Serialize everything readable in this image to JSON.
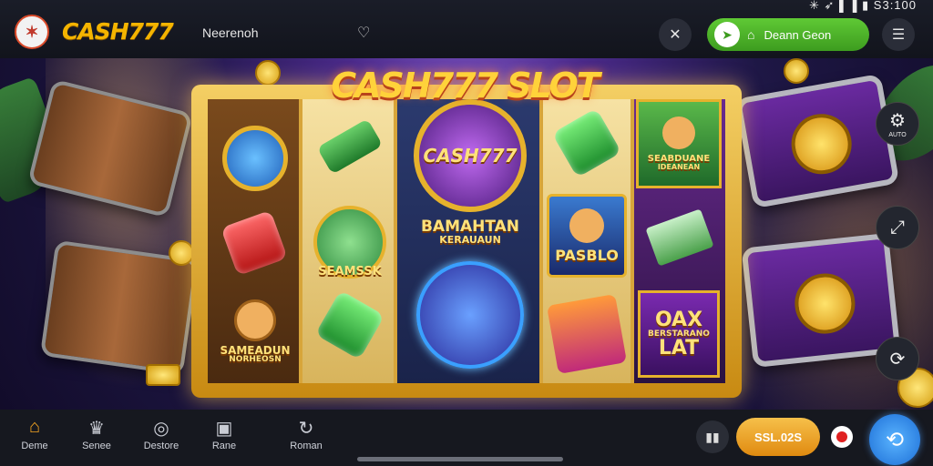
{
  "header": {
    "logo_icon": "slot-logo-icon",
    "brand": "CASH777",
    "nav_text": "Neerenoh",
    "heart_icon": "heart-icon",
    "status_text": "✳ ➶ ▌▐ ▮ S3:100",
    "tools_icon": "tools-icon",
    "green_button_label": "Deann Geon",
    "menu_icon": "menu-icon"
  },
  "game": {
    "title": "CASH777 SLOT",
    "reel_labels": {
      "center_badge": "CASH777",
      "center_banner_main": "BAMAHTAN",
      "center_banner_sub": "KERAUAUN",
      "reel1_character": "SAMEADUN",
      "reel1_character_sub": "NORHEOSN",
      "reel2_character": "SEAMSSK",
      "reel4_character": "PASBLO",
      "reel5_character": "SEABDUANE",
      "reel5_character_sub": "IDEANEAN",
      "reel5_bonus_1": "OAX",
      "reel5_bonus_2": "BERSTARANO",
      "reel5_bonus_3": "LAT"
    },
    "colors": {
      "gold": "#f4cf64",
      "purple": "#4a2a8a",
      "accent_green": "#5fc935",
      "accent_orange": "#f5a623"
    }
  },
  "sidebar_right": {
    "settings_icon": "gear-icon",
    "settings_label": "AUTO",
    "stats_icon": "chart-icon",
    "refresh_icon": "refresh-icon"
  },
  "bottom_nav": {
    "tabs": [
      {
        "label": "Deme",
        "icon": "home-icon"
      },
      {
        "label": "Senee",
        "icon": "crown-icon"
      },
      {
        "label": "Destore",
        "icon": "search-icon"
      },
      {
        "label": "Rane",
        "icon": "chart-box-icon"
      },
      {
        "label": "Roman",
        "icon": "history-icon"
      }
    ],
    "balance": "SSL.02S",
    "spin_icon": "spin-icon"
  }
}
